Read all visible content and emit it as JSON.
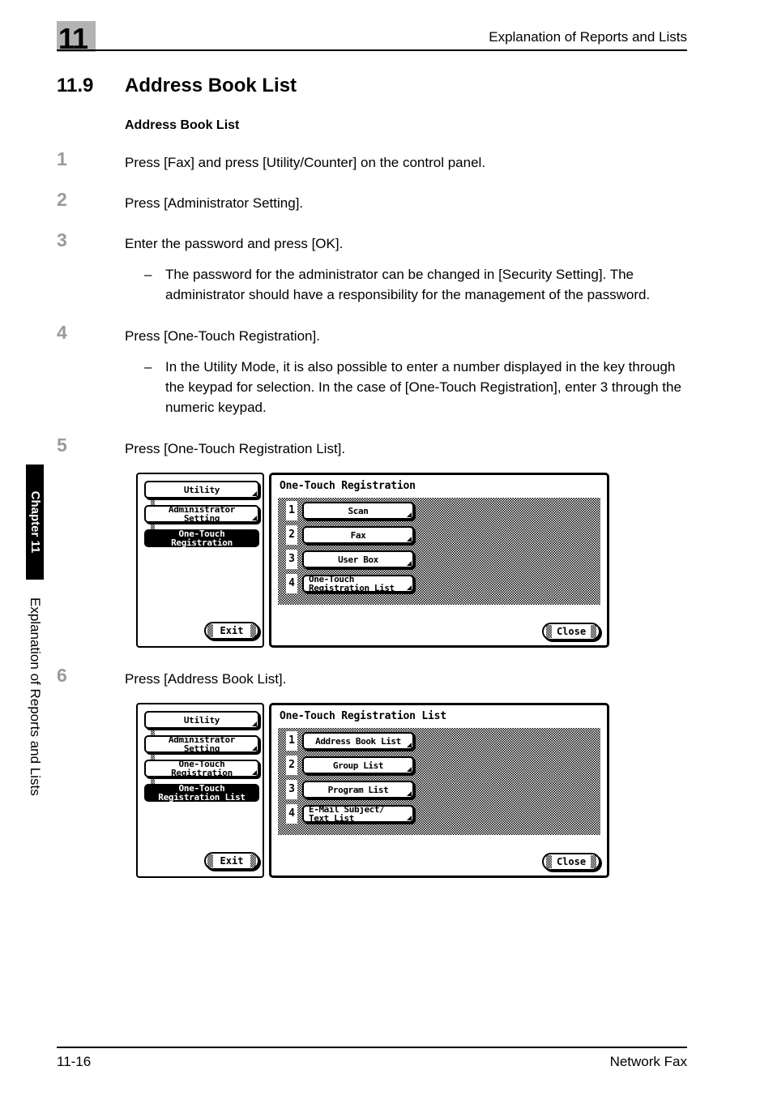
{
  "header": {
    "chapter_number": "11",
    "title": "Explanation of Reports and Lists"
  },
  "sidebar": {
    "chapter_tab": "Chapter 11",
    "section_label": "Explanation of Reports and Lists"
  },
  "section": {
    "number": "11.9",
    "title": "Address Book List",
    "subheading": "Address Book List"
  },
  "steps": [
    {
      "num": "1",
      "text": "Press [Fax] and press [Utility/Counter] on the control panel."
    },
    {
      "num": "2",
      "text": "Press [Administrator Setting]."
    },
    {
      "num": "3",
      "text": "Enter the password and press [OK].",
      "note_dash": "–",
      "note": "The password for the administrator can be changed in [Security Setting]. The administrator should have a responsibility for the management of the password."
    },
    {
      "num": "4",
      "text": "Press [One-Touch Registration].",
      "note_dash": "–",
      "note": "In the Utility Mode, it is also possible to enter a number displayed in the key through the keypad for selection. In the case of [One-Touch Registration], enter 3 through the numeric keypad."
    },
    {
      "num": "5",
      "text": "Press [One-Touch Registration List]."
    },
    {
      "num": "6",
      "text": "Press [Address Book List]."
    }
  ],
  "figure_step5": {
    "breadcrumb": [
      {
        "line1": "Utility",
        "line2": "",
        "selected": false
      },
      {
        "line1": "Administrator",
        "line2": "Setting",
        "selected": false
      },
      {
        "line1": "One-Touch",
        "line2": "Registration",
        "selected": true
      }
    ],
    "exit_label": "Exit",
    "dialog_title": "One-Touch Registration",
    "dialog_items": [
      {
        "num": "1",
        "line1": "Scan",
        "line2": ""
      },
      {
        "num": "2",
        "line1": "Fax",
        "line2": ""
      },
      {
        "num": "3",
        "line1": "User Box",
        "line2": ""
      },
      {
        "num": "4",
        "line1": "One-Touch",
        "line2": "Registration List"
      }
    ],
    "close_label": "Close"
  },
  "figure_step6": {
    "breadcrumb": [
      {
        "line1": "Utility",
        "line2": "",
        "selected": false
      },
      {
        "line1": "Administrator",
        "line2": "Setting",
        "selected": false
      },
      {
        "line1": "One-Touch",
        "line2": "Registration",
        "selected": false
      },
      {
        "line1": "One-Touch",
        "line2": "Registration List",
        "selected": true
      }
    ],
    "exit_label": "Exit",
    "dialog_title": "One-Touch Registration List",
    "dialog_items": [
      {
        "num": "1",
        "line1": "Address Book List",
        "line2": ""
      },
      {
        "num": "2",
        "line1": "Group List",
        "line2": ""
      },
      {
        "num": "3",
        "line1": "Program List",
        "line2": ""
      },
      {
        "num": "4",
        "line1": "E-Mail Subject/",
        "line2": "Text List"
      }
    ],
    "close_label": "Close"
  },
  "footer": {
    "page": "11-16",
    "document": "Network Fax"
  }
}
